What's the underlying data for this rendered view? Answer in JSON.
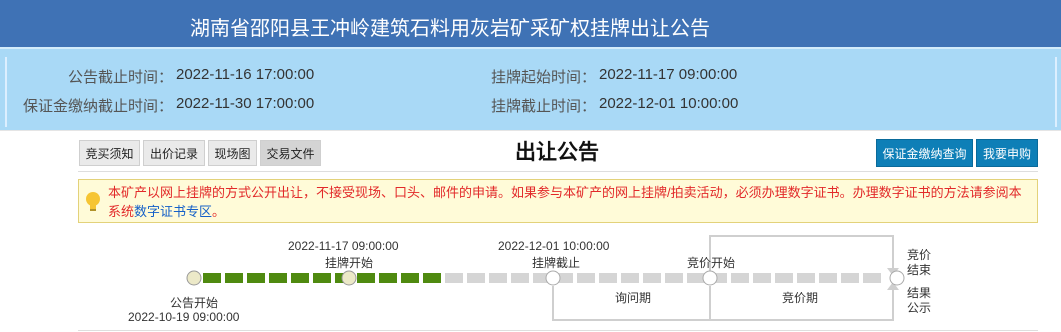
{
  "header": {
    "title": "湖南省邵阳县王冲岭建筑石料用灰岩矿采矿权挂牌出让公告"
  },
  "info": {
    "notice_deadline_label": "公告截止时间：",
    "notice_deadline_value": "2022-11-16 17:00:00",
    "deposit_deadline_label": "保证金缴纳截止时间：",
    "deposit_deadline_value": "2022-11-30 17:00:00",
    "listing_start_label": "挂牌起始时间：",
    "listing_start_value": "2022-11-17 09:00:00",
    "listing_end_label": "挂牌截止时间：",
    "listing_end_value": "2022-12-01 10:00:00"
  },
  "tabs": [
    "竞买须知",
    "出价记录",
    "现场图",
    "交易文件"
  ],
  "section_title": "出让公告",
  "buttons": {
    "deposit_query": "保证金缴纳查询",
    "apply": "我要申购"
  },
  "notice": {
    "text_part1": "本矿产以网上挂牌的方式公开出让，不接受现场、口头、邮件的申请。如果参与本矿产的网上挂牌/拍卖活动，必须办理数字证书。办理数字证书的方法请参阅本系统",
    "link": "数字证书专区",
    "text_part2": "。"
  },
  "timeline": {
    "listing_start_date": "2022-11-17 09:00:00",
    "listing_start_label": "挂牌开始",
    "listing_end_date": "2022-12-01 10:00:00",
    "listing_end_label": "挂牌截止",
    "bidding_start_label": "竞价开始",
    "bidding_end_label_1": "竞价",
    "bidding_end_label_2": "结束",
    "result_label_1": "结果",
    "result_label_2": "公示",
    "notice_start_label": "公告开始",
    "notice_start_date": "2022-10-19 09:00:00",
    "inquiry_period_label": "询问期",
    "bidding_period_label": "竞价期",
    "progress_segments_done": 11,
    "colors": {
      "done": "#4f8a10",
      "pending": "#d5d5d5",
      "node_done": "#ece9c8"
    }
  }
}
